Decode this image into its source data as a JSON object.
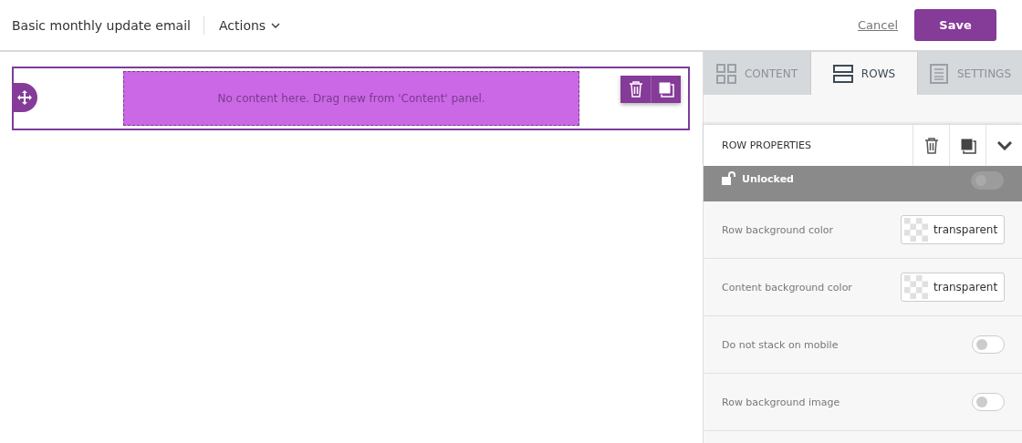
{
  "header": {
    "title": "Basic monthly update email",
    "actions_menu": "Actions",
    "cancel": "Cancel",
    "save": "Save"
  },
  "canvas": {
    "row": {
      "selected": true,
      "placeholder_text": "No content here. Drag new from 'Content' panel."
    }
  },
  "tabs": [
    {
      "label": "CONTENT",
      "selected": false
    },
    {
      "label": "ROWS",
      "selected": true
    },
    {
      "label": "SETTINGS",
      "selected": false
    }
  ],
  "row_properties": {
    "title": "ROW PROPERTIES",
    "lock": {
      "label": "Unlocked",
      "locked": false
    },
    "properties": [
      {
        "kind": "color",
        "label": "Row background color",
        "value": "transparent"
      },
      {
        "kind": "color",
        "label": "Content background color",
        "value": "transparent"
      },
      {
        "kind": "toggle",
        "label": "Do not stack on mobile",
        "on": false
      },
      {
        "kind": "toggle",
        "label": "Row background image",
        "on": false
      }
    ]
  }
}
